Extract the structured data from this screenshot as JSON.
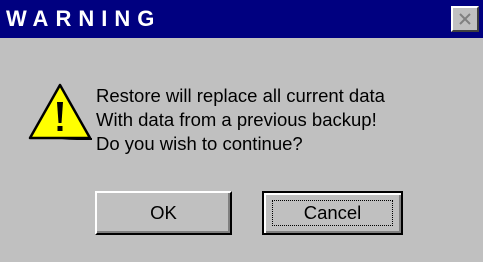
{
  "window": {
    "title": "WARNING",
    "close_icon": "close-icon"
  },
  "colors": {
    "titlebar": "#000080",
    "dialog_bg": "#c0c0c0",
    "warning_yellow": "#ffff00"
  },
  "icon": "warning-triangle-icon",
  "message": {
    "line1": "Restore will replace all current data",
    "line2": "With data from a previous backup!",
    "line3": "Do you wish to continue?"
  },
  "buttons": {
    "ok_label": "OK",
    "cancel_label": "Cancel"
  }
}
